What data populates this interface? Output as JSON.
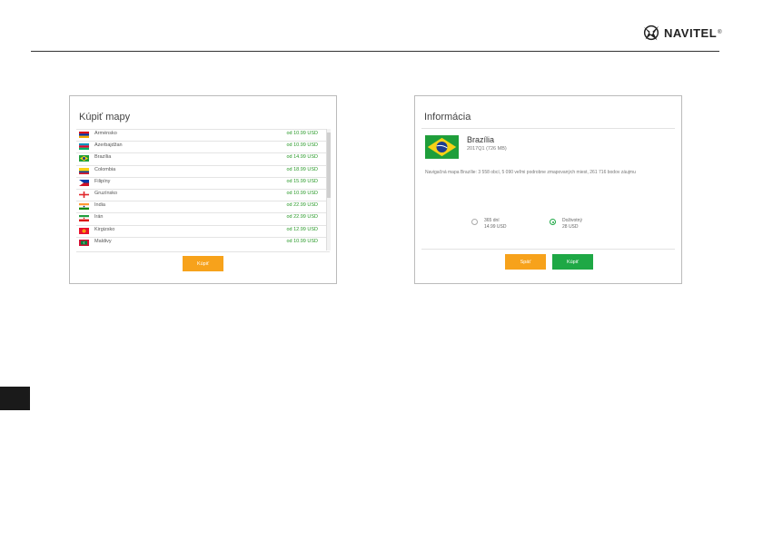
{
  "brand": {
    "name": "NAVITEL",
    "reg": "®"
  },
  "buy_panel": {
    "title": "Kúpiť mapy",
    "items": [
      {
        "name": "Arménsko",
        "price": "od 10.99 USD",
        "flag": "armenia"
      },
      {
        "name": "Azerbajdžan",
        "price": "od 10.99 USD",
        "flag": "azerbaijan"
      },
      {
        "name": "Brazília",
        "price": "od 14.99 USD",
        "flag": "brazil"
      },
      {
        "name": "Colombia",
        "price": "od 18.99 USD",
        "flag": "colombia"
      },
      {
        "name": "Filipíny",
        "price": "od 15.99 USD",
        "flag": "philippines"
      },
      {
        "name": "Gruzínsko",
        "price": "od 10.99 USD",
        "flag": "georgia"
      },
      {
        "name": "India",
        "price": "od 22.99 USD",
        "flag": "india"
      },
      {
        "name": "Irán",
        "price": "od 22.99 USD",
        "flag": "iran"
      },
      {
        "name": "Kirgizsko",
        "price": "od 12.99 USD",
        "flag": "kyrgyzstan"
      },
      {
        "name": "Maldivy",
        "price": "od 10.99 USD",
        "flag": "maldives"
      }
    ],
    "buy_label": "Kúpiť"
  },
  "info_panel": {
    "title": "Informácia",
    "map_name": "Brazília",
    "map_meta": "2017Q1 (726 MB)",
    "description": "Navigačná mapa Brazílie: 3 558 obcí, 5 090 veľmi podrobne zmapovaných miest, 261 716 bodov záujmu",
    "options": [
      {
        "label": "365 dní",
        "price": "14.99 USD",
        "selected": false
      },
      {
        "label": "Doživotný",
        "price": "28 USD",
        "selected": true
      }
    ],
    "back_label": "Späť",
    "buy_label": "Kúpiť"
  },
  "colors": {
    "accent_orange": "#f7a21b",
    "accent_green": "#1ea845",
    "price_green": "#2a9a2a"
  }
}
